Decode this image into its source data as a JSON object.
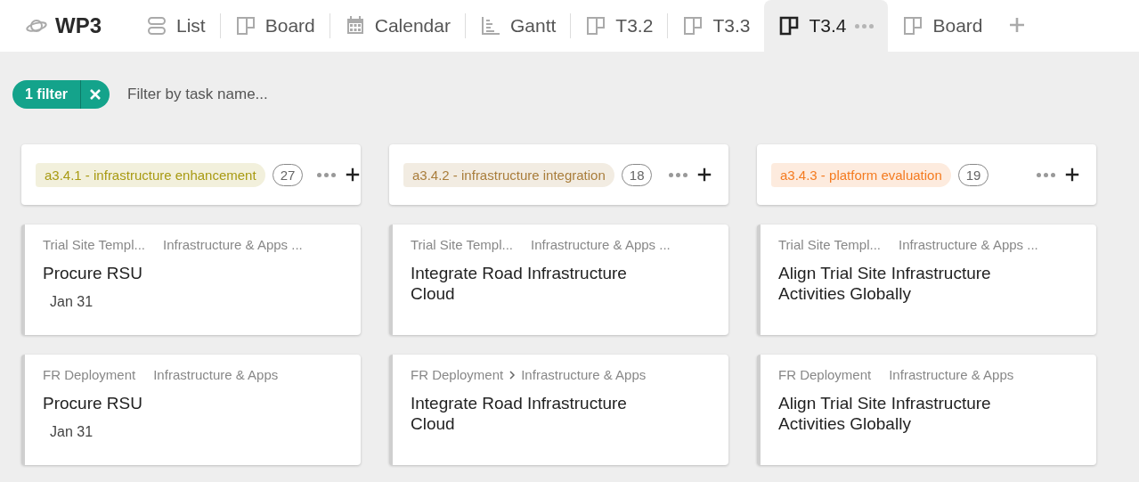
{
  "workspace": {
    "title": "WP3"
  },
  "tabs": [
    {
      "label": "List",
      "kind": "list",
      "selected": false
    },
    {
      "label": "Board",
      "kind": "board",
      "selected": false
    },
    {
      "label": "Calendar",
      "kind": "calendar",
      "selected": false
    },
    {
      "label": "Gantt",
      "kind": "gantt",
      "selected": false
    },
    {
      "label": "T3.2",
      "kind": "board",
      "selected": false
    },
    {
      "label": "T3.3",
      "kind": "board",
      "selected": false
    },
    {
      "label": "T3.4",
      "kind": "board",
      "selected": true
    },
    {
      "label": "Board",
      "kind": "board",
      "selected": false
    }
  ],
  "filter": {
    "chip": "1 filter",
    "placeholder": "Filter by task name..."
  },
  "columns": [
    {
      "label": "a3.4.1 - infrastructure enhancement",
      "count": "27",
      "color": "#a89a12",
      "cards": [
        {
          "crumb": "Trial Site Templ...",
          "section": "Infrastructure & Apps ...",
          "title": "Procure RSU",
          "date": "Jan 31"
        },
        {
          "crumb": "FR Deployment",
          "section": "Infrastructure & Apps",
          "title": "Procure RSU",
          "date": "Jan 31"
        }
      ]
    },
    {
      "label": "a3.4.2 - infrastructure integration",
      "count": "18",
      "color": "#a97d3b",
      "cards": [
        {
          "crumb": "Trial Site Templ...",
          "section": "Infrastructure & Apps ...",
          "title": "Integrate Road Infrastructure Cloud"
        },
        {
          "crumb": "FR Deployment",
          "section": "Infrastructure & Apps",
          "chevron": true,
          "title": "Integrate Road Infrastructure Cloud"
        }
      ]
    },
    {
      "label": "a3.4.3 - platform evaluation",
      "count": "19",
      "color": "#f47b20",
      "cards": [
        {
          "crumb": "Trial Site Templ...",
          "section": "Infrastructure & Apps ...",
          "title": "Align Trial Site Infrastructure Activities Globally"
        },
        {
          "crumb": "FR Deployment",
          "section": "Infrastructure & Apps",
          "title": "Align Trial Site Infrastructure Activities Globally"
        }
      ]
    }
  ]
}
